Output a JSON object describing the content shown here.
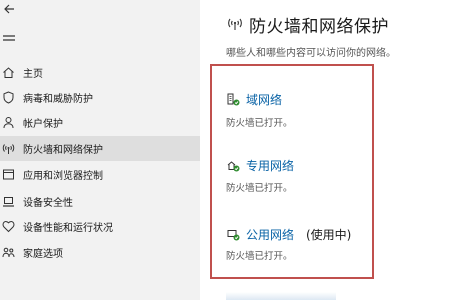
{
  "sidebar": {
    "items": [
      {
        "label": "主页",
        "icon": "home-icon"
      },
      {
        "label": "病毒和威胁防护",
        "icon": "shield-icon"
      },
      {
        "label": "帐户保护",
        "icon": "person-icon"
      },
      {
        "label": "防火墙和网络保护",
        "icon": "wifi-icon",
        "selected": true
      },
      {
        "label": "应用和浏览器控制",
        "icon": "app-window-icon"
      },
      {
        "label": "设备安全性",
        "icon": "laptop-icon"
      },
      {
        "label": "设备性能和运行状况",
        "icon": "heart-icon"
      },
      {
        "label": "家庭选项",
        "icon": "family-icon"
      }
    ]
  },
  "main": {
    "title": "防火墙和网络保护",
    "subtitle": "哪些人和哪些内容可以访问你的网络。",
    "networks": [
      {
        "name": "域网络",
        "status": "防火墙已打开。",
        "icon": "domain-network-icon",
        "active": ""
      },
      {
        "name": "专用网络",
        "status": "防火墙已打开。",
        "icon": "private-network-icon",
        "active": ""
      },
      {
        "name": "公用网络",
        "status": "防火墙已打开。",
        "icon": "public-network-icon",
        "active": "(使用中)"
      }
    ]
  },
  "colors": {
    "accent": "#0a63a6",
    "highlight_border": "#c0504d",
    "status_ok": "#2e8b2e",
    "sidebar_bg": "#f2f2f2"
  }
}
